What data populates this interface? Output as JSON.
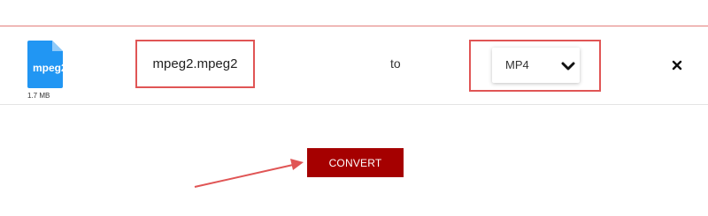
{
  "file": {
    "extension_label": "mpeg2",
    "size": "1.7 MB",
    "name": "mpeg2.mpeg2",
    "icon": "file-icon",
    "icon_color": "#2196f3"
  },
  "conversion": {
    "to_label": "to",
    "target_format": "MP4",
    "dropdown_icon": "chevron-down-icon",
    "remove_icon": "close-icon"
  },
  "actions": {
    "convert_label": "CONVERT",
    "convert_color": "#a50000"
  },
  "annotations": {
    "highlight_color": "#e05555"
  }
}
